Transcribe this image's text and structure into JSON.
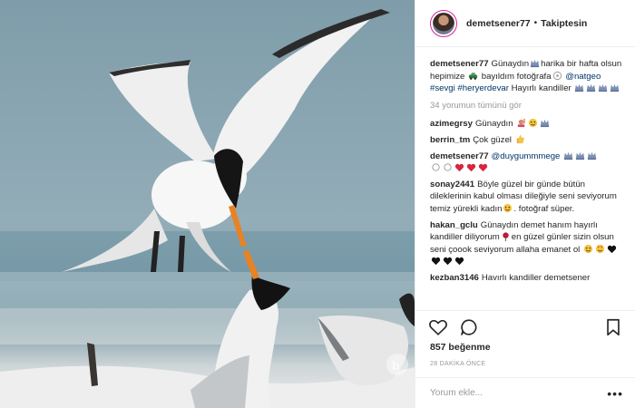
{
  "post": {
    "username": "demetsener77",
    "separator": "•",
    "follow_state": "Takiptesin"
  },
  "caption": {
    "user": "demetsener77",
    "t1": "Günaydın",
    "t2": "harika bir hafta olsun hepimize",
    "t3": "bayıldım fotoğrafa",
    "tag1": "@natgeo",
    "tag2": "#sevgi",
    "tag3": "#heryerdevar",
    "t4": "Hayırlı kandiller"
  },
  "view_all": "34 yorumun tümünü gör",
  "comments": [
    {
      "user": "azimegrsy",
      "text": "Günaydın"
    },
    {
      "user": "berrin_tm",
      "text": "Çok güzel"
    },
    {
      "user": "demetsener77",
      "mention": "@duygummmege"
    },
    {
      "user": "sonay2441",
      "text1": "Böyle güzel bir günde bütün dileklerinin kabul olması dileğiyle seni seviyorum temiz yürekli kadın",
      "text2": ". fotoğraf süper."
    },
    {
      "user": "hakan_gclu",
      "text1": "Günaydın demet hanım hayırlı kandiller diliyorum",
      "text2": "en güzel günler sizin olsun seni çoook seviyorum allaha emanet ol"
    },
    {
      "user": "kezban3146",
      "text": "Havırlı kandiller demetsener"
    }
  ],
  "likes": "857 beğenme",
  "time": "28 DAKİKA ÖNCE",
  "add_comment_placeholder": "Yorum ekle...",
  "more_options": "•••",
  "icons": [
    "heart-icon",
    "comment-icon",
    "bookmark-icon",
    "crown-emoji",
    "car-emoji",
    "flower-emoji",
    "thumbs-up-emoji",
    "heart-emoji",
    "black-heart-emoji"
  ]
}
